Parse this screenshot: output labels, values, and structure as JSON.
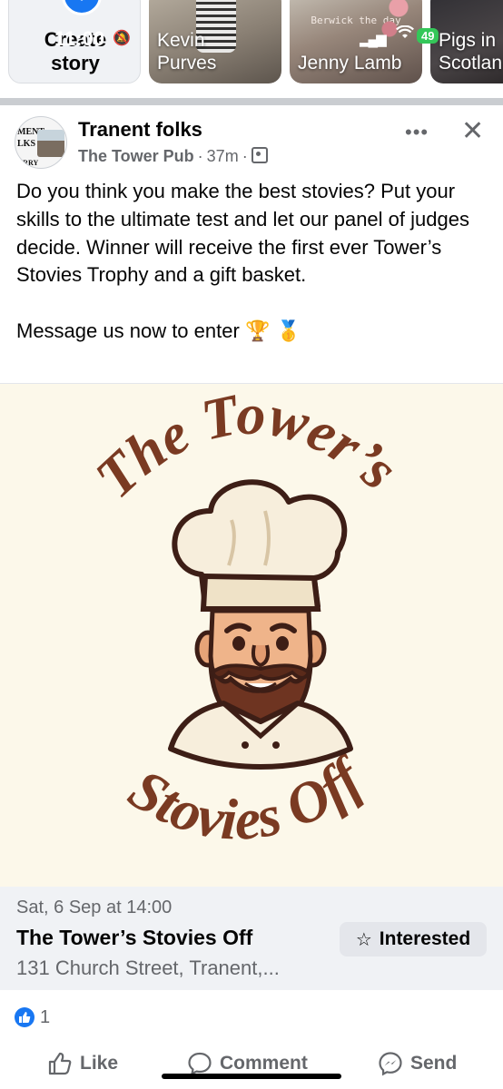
{
  "status_bar": {
    "time": "11:00",
    "battery": "49"
  },
  "stories": [
    {
      "label_line1": "Create",
      "label_line2": "story"
    },
    {
      "name_line1": "Kevin",
      "name_line2": "Purves"
    },
    {
      "name": "Jenny Lamb",
      "overlay_text": "Berwick the day"
    },
    {
      "name_line1": "Pigs in",
      "name_line2": "Scotlan"
    }
  ],
  "post": {
    "group_name": "Tranent folks",
    "author": "The Tower Pub",
    "time": "37m",
    "avatar_text": "MENT\nLKS\nORRY",
    "text_paragraph1": "Do you think you make the best stovies? Put your skills to the ultimate test and let our panel of judges decide. Winner will receive the first ever Tower’s Stovies Trophy and a gift basket.",
    "text_paragraph2": "Message us now to enter",
    "emojis": "🏆 🥇"
  },
  "event_image": {
    "top_text": "The Tower’s",
    "bottom_text": "Stovies Off",
    "colors": {
      "background": "#fcf8ea",
      "lettering": "#7a3a22",
      "outline": "#3d1e16"
    }
  },
  "event": {
    "date": "Sat, 6 Sep at 14:00",
    "title": "The Tower’s Stovies Off",
    "location": "131 Church Street, Tranent,...",
    "interested_label": "Interested"
  },
  "reactions": {
    "count": "1"
  },
  "actions": {
    "like": "Like",
    "comment": "Comment",
    "send": "Send"
  },
  "colors": {
    "accent": "#1877f2",
    "secondary_text": "#65676b",
    "panel": "#f0f2f5"
  }
}
